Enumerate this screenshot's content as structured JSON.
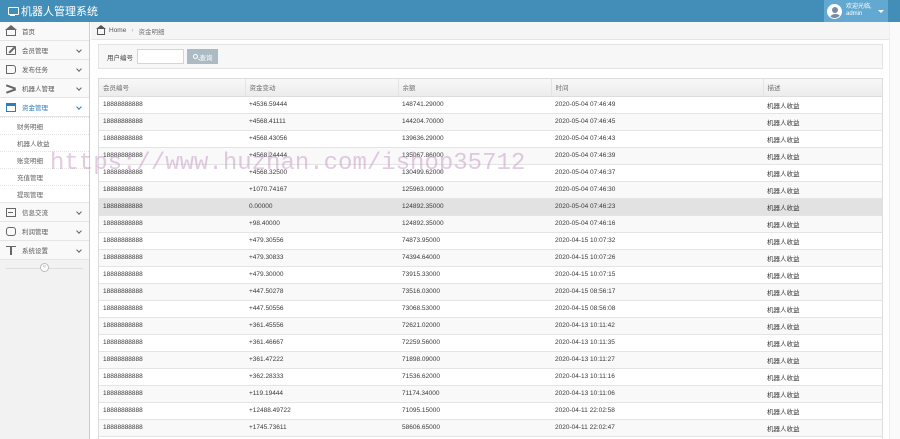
{
  "app": {
    "title": "机器人管理系统"
  },
  "user": {
    "greeting": "欢迎光临,",
    "name": "admin"
  },
  "sidebar": {
    "items": [
      {
        "label": "首页",
        "icon": "home-icon"
      },
      {
        "label": "会员管理",
        "icon": "edit-icon"
      },
      {
        "label": "发布任务",
        "icon": "tag-icon"
      },
      {
        "label": "机器人管理",
        "icon": "shuffle-icon"
      },
      {
        "label": "资金管理",
        "icon": "calendar-icon"
      }
    ],
    "submenu": [
      {
        "label": "财务明细"
      },
      {
        "label": "机器人收益"
      },
      {
        "label": "账变明细"
      },
      {
        "label": "充值管理"
      },
      {
        "label": "提现管理"
      }
    ],
    "items_after": [
      {
        "label": "信息交流",
        "icon": "doc-icon"
      },
      {
        "label": "利润管理",
        "icon": "dollar-icon"
      },
      {
        "label": "系统设置",
        "icon": "text-icon"
      }
    ]
  },
  "breadcrumb": {
    "home": "Home",
    "current": "资金明细"
  },
  "search": {
    "label": "用户编号",
    "placeholder": "",
    "value": "",
    "button": "查询"
  },
  "table": {
    "columns": [
      "会员编号",
      "资金变动",
      "余额",
      "时间",
      "描述"
    ],
    "rows": [
      [
        "18888888888",
        "+4536.59444",
        "148741.29000",
        "2020-05-04 07:46:49",
        "机器人收益"
      ],
      [
        "18888888888",
        "+4568.41111",
        "144204.70000",
        "2020-05-04 07:46:45",
        "机器人收益"
      ],
      [
        "18888888888",
        "+4568.43056",
        "139636.29000",
        "2020-05-04 07:46:43",
        "机器人收益"
      ],
      [
        "18888888888",
        "+4568.24444",
        "135067.86000",
        "2020-05-04 07:46:39",
        "机器人收益"
      ],
      [
        "18888888888",
        "+4568.32500",
        "130499.62000",
        "2020-05-04 07:46:37",
        "机器人收益"
      ],
      [
        "18888888888",
        "+1070.74167",
        "125963.09000",
        "2020-05-04 07:46:30",
        "机器人收益"
      ],
      [
        "18888888888",
        "0.00000",
        "124892.35000",
        "2020-05-04 07:46:23",
        "机器人收益"
      ],
      [
        "18888888888",
        "+98.40000",
        "124892.35000",
        "2020-05-04 07:46:16",
        "机器人收益"
      ],
      [
        "18888888888",
        "+479.30556",
        "74873.95000",
        "2020-04-15 10:07:32",
        "机器人收益"
      ],
      [
        "18888888888",
        "+479.30833",
        "74394.64000",
        "2020-04-15 10:07:26",
        "机器人收益"
      ],
      [
        "18888888888",
        "+479.30000",
        "73915.33000",
        "2020-04-15 10:07:15",
        "机器人收益"
      ],
      [
        "18888888888",
        "+447.50278",
        "73516.03000",
        "2020-04-15 08:56:17",
        "机器人收益"
      ],
      [
        "18888888888",
        "+447.50556",
        "73068.53000",
        "2020-04-15 08:56:08",
        "机器人收益"
      ],
      [
        "18888888888",
        "+361.45556",
        "72621.02000",
        "2020-04-13 10:11:42",
        "机器人收益"
      ],
      [
        "18888888888",
        "+361.46667",
        "72259.56000",
        "2020-04-13 10:11:35",
        "机器人收益"
      ],
      [
        "18888888888",
        "+361.47222",
        "71898.09000",
        "2020-04-13 10:11:27",
        "机器人收益"
      ],
      [
        "18888888888",
        "+362.28333",
        "71536.62000",
        "2020-04-13 10:11:16",
        "机器人收益"
      ],
      [
        "18888888888",
        "+119.19444",
        "71174.34000",
        "2020-04-13 10:11:06",
        "机器人收益"
      ],
      [
        "18888888888",
        "+12488.49722",
        "71095.15000",
        "2020-04-11 22:02:58",
        "机器人收益"
      ],
      [
        "18888888888",
        "+1745.73611",
        "58606.65000",
        "2020-04-11 22:02:47",
        "机器人收益"
      ]
    ]
  },
  "watermark": "https://www.huzhan.com/ishop35712",
  "colors": {
    "navbar": "#438eb9",
    "user_box": "#62a8d1",
    "active": "#2b7dbc",
    "button": "#abbac3"
  }
}
